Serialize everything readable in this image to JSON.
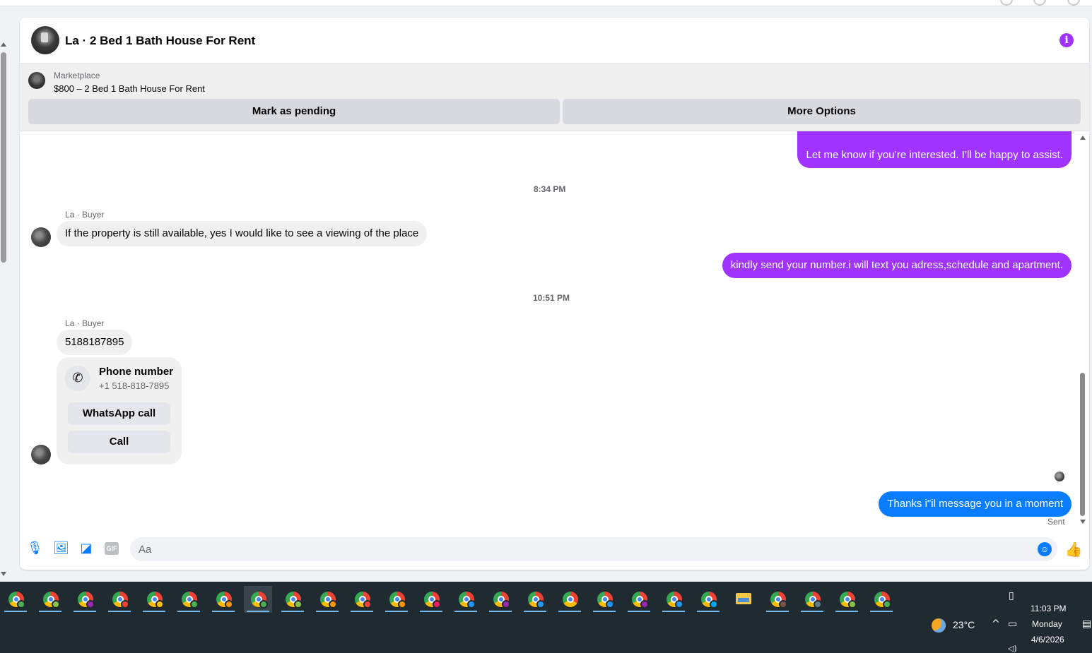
{
  "colors": {
    "accent_purple": "#a033ff",
    "accent_blue": "#0a7cff",
    "bubble_incoming": "#f0f0f0",
    "taskbar": "#202a31"
  },
  "header": {
    "title": "La · 2 Bed 1 Bath House For Rent",
    "info_icon": "info-icon",
    "info_glyph": "i"
  },
  "marketplace": {
    "label": "Marketplace",
    "item": "$800 – 2 Bed 1 Bath House For Rent",
    "buttons": {
      "mark_pending": "Mark as pending",
      "more_options": "More Options"
    }
  },
  "messages": {
    "partial_outgoing": "Let me know if you’re interested. I’ll be happy to assist.",
    "time_1": "8:34 PM",
    "sender_1": "La · Buyer",
    "incoming_1": "If the property is still available, yes I would like to see a viewing of the place",
    "outgoing_1": "kindly send your number.i will text you adress,schedule and apartment.",
    "time_2": "10:51 PM",
    "sender_2": "La · Buyer",
    "incoming_2": "5188187895",
    "phone_card": {
      "title": "Phone number",
      "number": "+1 518-818-7895",
      "whatsapp_label": "WhatsApp call",
      "call_label": "Call",
      "icon": "phone-icon"
    },
    "outgoing_2": "Thanks i\"il message you in a moment",
    "status": "Sent"
  },
  "composer": {
    "placeholder": "Aa",
    "value": "",
    "gif_label": "GIF",
    "icons": [
      "microphone-icon",
      "photo-icon",
      "sticker-icon",
      "gif-icon",
      "emoji-icon",
      "like-icon"
    ]
  },
  "taskbar": {
    "apps": [
      {
        "name": "chrome",
        "badge": "#4caf50"
      },
      {
        "name": "chrome",
        "badge": "#8bc34a"
      },
      {
        "name": "chrome",
        "badge": "#9c27b0"
      },
      {
        "name": "chrome",
        "badge": "#f44336"
      },
      {
        "name": "chrome",
        "badge": "#ffc107"
      },
      {
        "name": "chrome",
        "badge": "#4caf50"
      },
      {
        "name": "chrome",
        "badge": "#ff9800"
      },
      {
        "name": "chrome",
        "badge": "#4caf50",
        "active": true
      },
      {
        "name": "chrome",
        "badge": "#8bc34a"
      },
      {
        "name": "chrome",
        "badge": "#ff9800"
      },
      {
        "name": "chrome",
        "badge": "#f44336"
      },
      {
        "name": "chrome",
        "badge": "#ff9800"
      },
      {
        "name": "chrome",
        "badge": "#e91e63"
      },
      {
        "name": "chrome",
        "badge": "#2196f3"
      },
      {
        "name": "chrome",
        "badge": "#9c27b0"
      },
      {
        "name": "chrome",
        "badge": "#2196f3"
      },
      {
        "name": "chrome",
        "badge": ""
      },
      {
        "name": "chrome",
        "badge": "#2196f3"
      },
      {
        "name": "chrome",
        "badge": "#9c27b0"
      },
      {
        "name": "chrome",
        "badge": "#2196f3"
      },
      {
        "name": "chrome",
        "badge": "#03a9f4"
      },
      {
        "name": "file-explorer",
        "badge": ""
      },
      {
        "name": "chrome",
        "badge": "#795548"
      },
      {
        "name": "chrome",
        "badge": "#607d8b"
      },
      {
        "name": "chrome",
        "badge": "#8bc34a"
      },
      {
        "name": "chrome",
        "badge": "#4caf50"
      }
    ],
    "weather": "23°C",
    "time": "11:03 PM",
    "day": "Monday",
    "date": "4/6/2026"
  }
}
